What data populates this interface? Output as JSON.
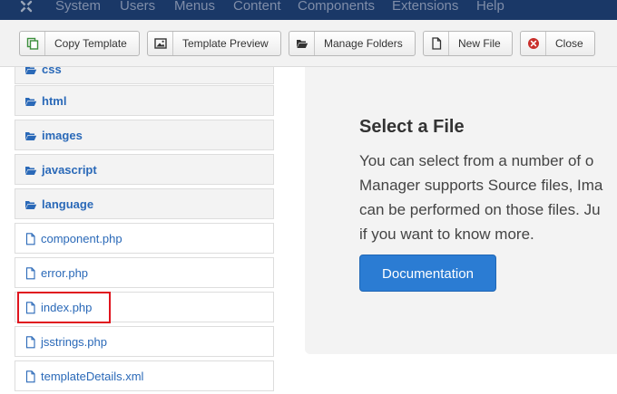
{
  "navbar": {
    "menu": [
      "System",
      "Users",
      "Menus",
      "Content",
      "Components",
      "Extensions",
      "Help"
    ]
  },
  "toolbar": {
    "copy_template": "Copy Template",
    "template_preview": "Template Preview",
    "manage_folders": "Manage Folders",
    "new_file": "New File",
    "close": "Close"
  },
  "tree": {
    "folders": [
      "css",
      "html",
      "images",
      "javascript",
      "language"
    ],
    "files": [
      "component.php",
      "error.php",
      "index.php",
      "jsstrings.php",
      "templateDetails.xml"
    ]
  },
  "panel": {
    "title": "Select a File",
    "lines": [
      "You can select from a number of o",
      "Manager supports Source files, Ima",
      "can be performed on those files. Ju",
      "if you want to know more."
    ],
    "button": "Documentation"
  },
  "colors": {
    "navbar": "#1a3867",
    "link": "#2a69b8",
    "primary_button": "#2b7cd3",
    "highlight": "#e0141e",
    "close_icon": "#c9302c",
    "copy_icon": "#3c8f3c"
  }
}
